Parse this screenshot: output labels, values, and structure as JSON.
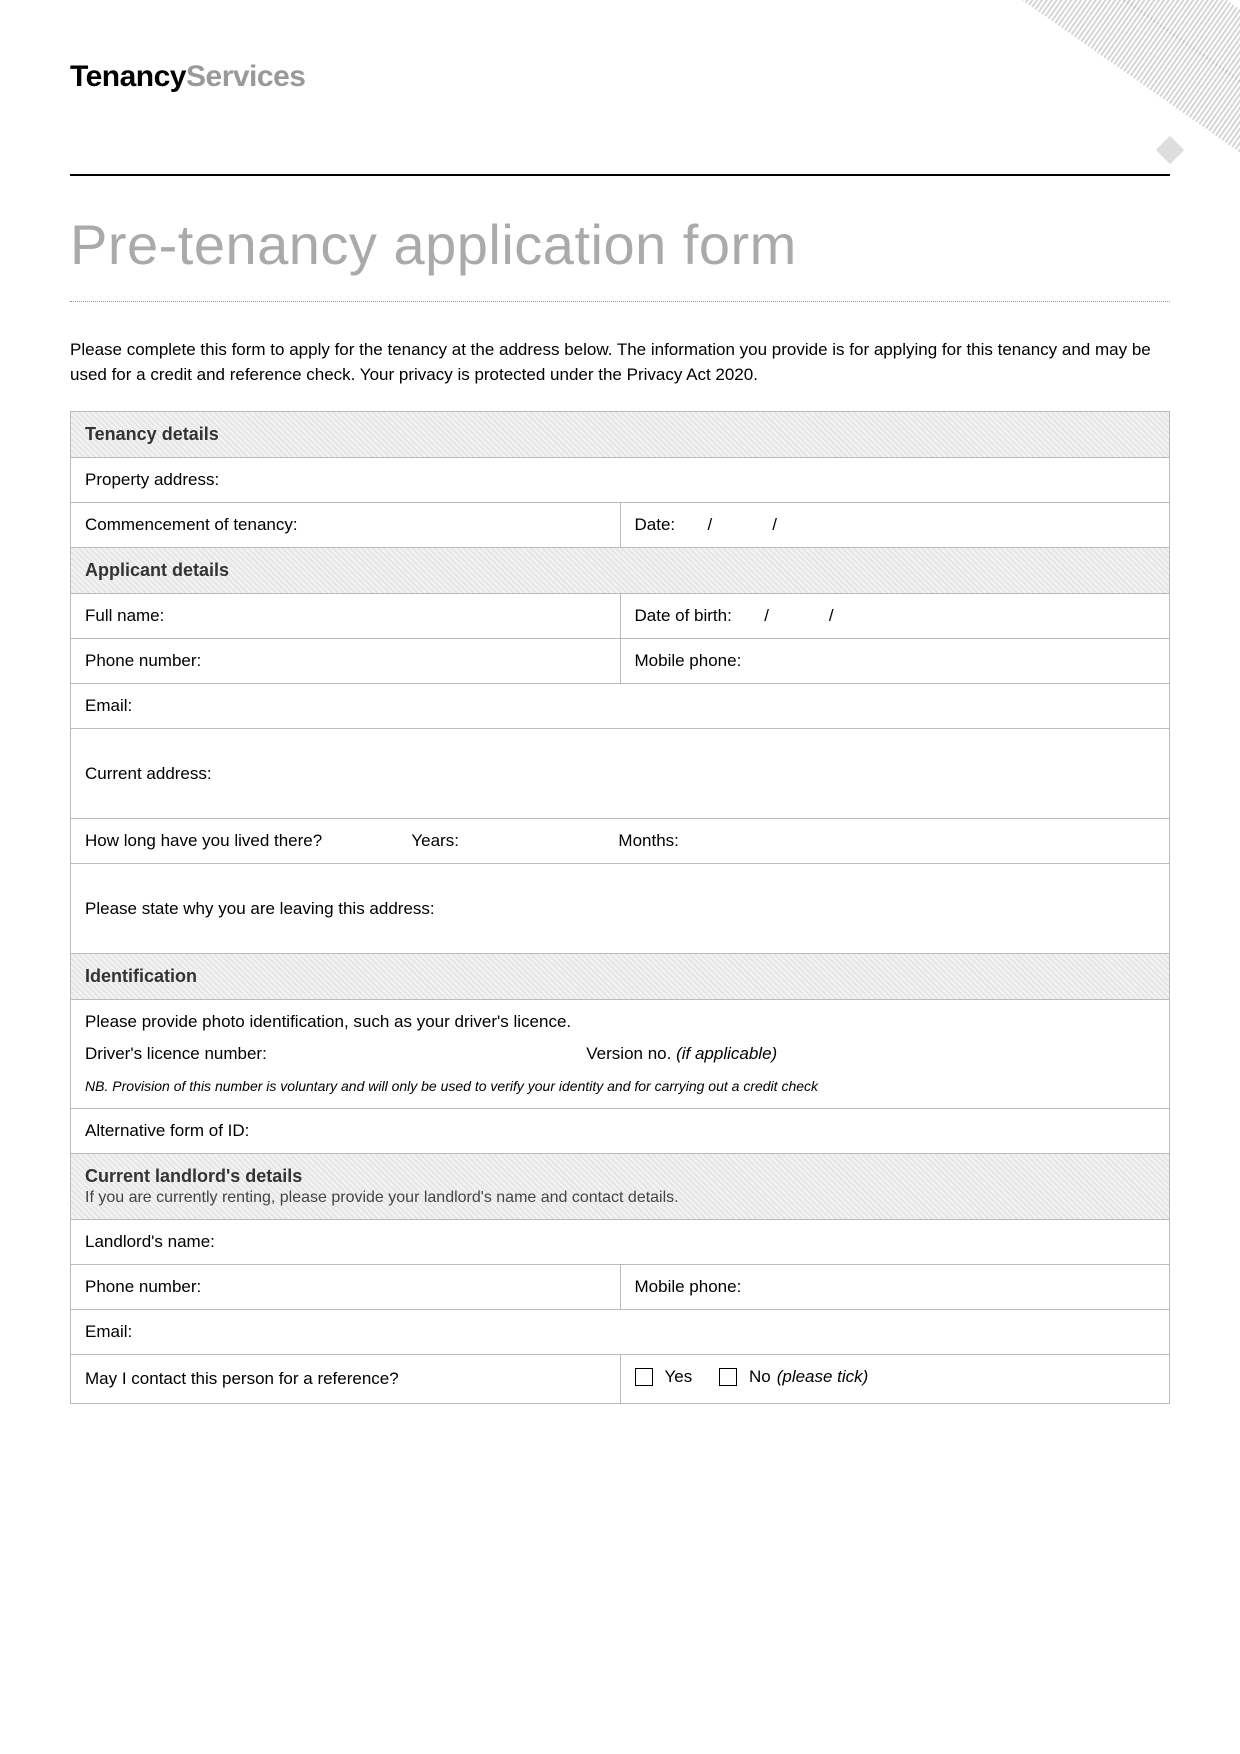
{
  "logo": {
    "part1": "Tenancy",
    "part2": "Services"
  },
  "title": "Pre-tenancy application form",
  "intro": "Please complete this form to apply for the tenancy at the address below. The information you provide is for applying for this tenancy and may be used for a credit and reference check. Your privacy is protected under the Privacy Act 2020.",
  "sections": {
    "tenancy_details": "Tenancy details",
    "applicant_details": "Applicant details",
    "identification": "Identification",
    "current_landlord": "Current landlord's details",
    "current_landlord_sub": "If you are currently renting, please provide your landlord's name and contact details."
  },
  "labels": {
    "property_address": "Property address:",
    "commencement": "Commencement of tenancy:",
    "date": "Date:",
    "full_name": "Full name:",
    "date_of_birth": "Date of birth:",
    "phone_number": "Phone number:",
    "mobile_phone": "Mobile phone:",
    "email": "Email:",
    "current_address": "Current address:",
    "how_long": "How long have you lived there?",
    "years": "Years:",
    "months": "Months:",
    "leaving_reason": "Please state why you are leaving this address:",
    "photo_id_prompt": "Please provide photo identification, such as your driver's licence.",
    "drivers_licence_number": "Driver's licence number:",
    "version_no": "Version no.",
    "if_applicable": "(if applicable)",
    "nb_provision": "NB. Provision of this number is voluntary and will only be used to verify your identity and for carrying out a credit check",
    "alt_id": "Alternative form of ID:",
    "landlord_name": "Landlord's name:",
    "may_contact": "May I contact this person for a reference?",
    "yes": "Yes",
    "no": "No",
    "please_tick": "(please tick)",
    "slash": "/"
  },
  "values": {
    "property_address": "",
    "commencement_date_d": "",
    "commencement_date_m": "",
    "commencement_date_y": "",
    "full_name": "",
    "dob_d": "",
    "dob_m": "",
    "dob_y": "",
    "phone": "",
    "mobile": "",
    "email": "",
    "current_address": "",
    "years": "",
    "months": "",
    "leaving_reason": "",
    "drivers_licence_number": "",
    "version_no": "",
    "alt_id": "",
    "landlord_name": "",
    "landlord_phone": "",
    "landlord_mobile": "",
    "landlord_email": "",
    "contact_ref_yes": false,
    "contact_ref_no": false
  }
}
